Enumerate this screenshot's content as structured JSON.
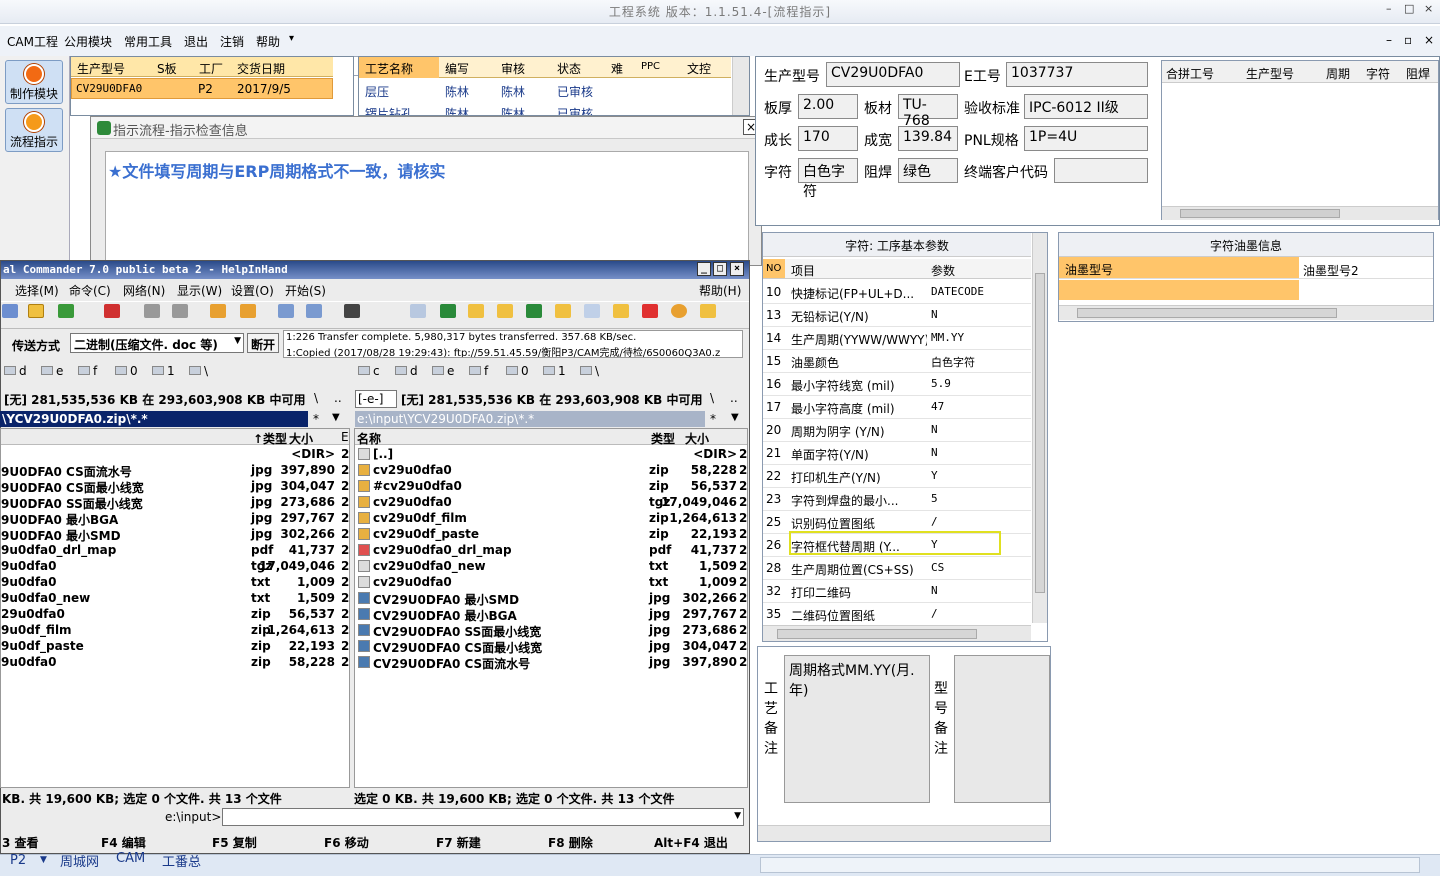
{
  "window": {
    "title": "工程系统 版本：1.1.51.4-[流程指示]",
    "controls": [
      "–",
      "□",
      "×"
    ]
  },
  "menu": {
    "items": [
      "CAM工程",
      "公用模块",
      "常用工具",
      "退出",
      "注销",
      "帮助"
    ],
    "help_arrow": "▾",
    "mdi_controls": [
      "–",
      "▫",
      "×"
    ]
  },
  "left_toolbar": {
    "buttons": [
      "制作模块",
      "流程指示"
    ]
  },
  "top_grid": {
    "headers": [
      "生产型号",
      "S板",
      "工厂",
      "交货日期"
    ],
    "row": [
      "CV29U0DFA0",
      "P2",
      "2017/9/5"
    ]
  },
  "process_grid": {
    "headers": [
      "工艺名称",
      "编写",
      "审核",
      "状态",
      "难",
      "PPC",
      "文控"
    ],
    "rows": [
      [
        "层压",
        "陈林",
        "陈林",
        "已审核"
      ],
      [
        "锣片钻孔",
        "陈林",
        "陈林",
        "已审核"
      ]
    ]
  },
  "dialog": {
    "title": "指示流程-指示检查信息",
    "message": "★文件填写周期与ERP周期格式不一致，请核实"
  },
  "info": {
    "fields": [
      {
        "label": "生产型号",
        "value": "CV29U0DFA0"
      },
      {
        "label": "E工号",
        "value": "1037737"
      },
      {
        "label": "板厚",
        "value": "2.00"
      },
      {
        "label": "板材",
        "value": "TU-768"
      },
      {
        "label": "验收标准",
        "value": "IPC-6012 II级"
      },
      {
        "label": "成长",
        "value": "170"
      },
      {
        "label": "成宽",
        "value": "139.84"
      },
      {
        "label": "PNL规格",
        "value": "1P=4U"
      },
      {
        "label": "字符",
        "value": "白色字符"
      },
      {
        "label": "阻焊",
        "value": "绿色"
      },
      {
        "label": "终端客户代码",
        "value": ""
      }
    ]
  },
  "merge_grid": {
    "headers": [
      "合拼工号",
      "生产型号",
      "周期",
      "字符",
      "阻焊"
    ]
  },
  "params": {
    "title": "字符: 工序基本参数",
    "headers": [
      "NO",
      "项目",
      "参数"
    ],
    "rows": [
      [
        "10",
        "快捷标记(FP+UL+D...",
        "DATECODE"
      ],
      [
        "13",
        "无铅标记(Y/N)",
        "N"
      ],
      [
        "14",
        "生产周期(YYWW/WWYY)",
        "MM.YY"
      ],
      [
        "15",
        "油墨颜色",
        "白色字符"
      ],
      [
        "16",
        "最小字符线宽 (mil)",
        "5.9"
      ],
      [
        "17",
        "最小字符高度 (mil)",
        "47"
      ],
      [
        "20",
        "周期为阴字 (Y/N)",
        "N"
      ],
      [
        "21",
        "单面字符(Y/N)",
        "N"
      ],
      [
        "22",
        "打印机生产(Y/N)",
        "Y"
      ],
      [
        "23",
        "字符到焊盘的最小...",
        "5"
      ],
      [
        "25",
        "识别码位置图纸",
        "/"
      ],
      [
        "26",
        "字符框代替周期 (Y...",
        "Y"
      ],
      [
        "28",
        "生产周期位置(CS+SS)",
        "CS"
      ],
      [
        "32",
        "打印二维码",
        "N"
      ],
      [
        "35",
        "二维码位置图纸",
        "/"
      ]
    ]
  },
  "ink": {
    "title": "字符油墨信息",
    "headers": [
      "油墨型号",
      "油墨型号2"
    ]
  },
  "remarks": {
    "process_label": "工艺备注",
    "process_text": "周期格式MM.YY(月.年)",
    "model_label": "型号备注"
  },
  "tc": {
    "title": "al Commander 7.0 public beta 2 - HelpInHand",
    "title_controls": [
      "_",
      "□",
      "×"
    ],
    "menu": [
      "选择(M)",
      "命令(C)",
      "网络(N)",
      "显示(W)",
      "设置(O)",
      "开始(S)"
    ],
    "help": "帮助(H)",
    "transfer_label": "传送方式",
    "transfer_mode": "二进制(压缩文件. doc 等)",
    "disconnect": "断开",
    "log": [
      "1:226 Transfer complete. 5,980,317 bytes transferred. 357.68 KB/sec.",
      "1:Copied (2017/08/28 19:29:43): ftp://59.51.45.59/衡阳P3/CAM完成/待检/6S0060Q3A0.z"
    ],
    "drives_left": [
      "d",
      "e",
      "f",
      "0",
      "1",
      "\\"
    ],
    "drives_right": [
      "c",
      "d",
      "e",
      "f",
      "0",
      "1",
      "\\"
    ],
    "left_free": "[无] 281,535,536 KB 在 293,603,908 KB 中可用",
    "right_free": "[无] 281,535,536 KB 在 293,603,908 KB 中可用",
    "right_drive": "[-e-]",
    "left_path": "\\YCV29U0DFA0.zip\\*.*",
    "right_path": "e:\\input\\YCV29U0DFA0.zip\\*.*",
    "left_cols": [
      "↑类型",
      "大小",
      "E"
    ],
    "right_cols": [
      "名称",
      "类型",
      "大小"
    ],
    "left_files": [
      [
        "",
        "",
        "<DIR>",
        "2"
      ],
      [
        "9U0DFA0 CS面流水号",
        "jpg",
        "397,890",
        "2"
      ],
      [
        "9U0DFA0 CS面最小线宽",
        "jpg",
        "304,047",
        "2"
      ],
      [
        "9U0DFA0 SS面最小线宽",
        "jpg",
        "273,686",
        "2"
      ],
      [
        "9U0DFA0 最小BGA",
        "jpg",
        "297,767",
        "2"
      ],
      [
        "9U0DFA0 最小SMD",
        "jpg",
        "302,266",
        "2"
      ],
      [
        "9u0dfa0_drl_map",
        "pdf",
        "41,737",
        "2"
      ],
      [
        "9u0dfa0",
        "tgz",
        "17,049,046",
        "2"
      ],
      [
        "9u0dfa0",
        "txt",
        "1,009",
        "2"
      ],
      [
        "9u0dfa0_new",
        "txt",
        "1,509",
        "2"
      ],
      [
        "29u0dfa0",
        "zip",
        "56,537",
        "2"
      ],
      [
        "9u0df_film",
        "zip",
        "1,264,613",
        "2"
      ],
      [
        "9u0df_paste",
        "zip",
        "22,193",
        "2"
      ],
      [
        "9u0dfa0",
        "zip",
        "58,228",
        "2"
      ]
    ],
    "right_files": [
      [
        "[..]",
        "",
        "<DIR>",
        "2"
      ],
      [
        "cv29u0dfa0",
        "zip",
        "58,228",
        "2"
      ],
      [
        "#cv29u0dfa0",
        "zip",
        "56,537",
        "2"
      ],
      [
        "cv29u0dfa0",
        "tgz",
        "17,049,046",
        "2"
      ],
      [
        "cv29u0df_film",
        "zip",
        "1,264,613",
        "2"
      ],
      [
        "cv29u0df_paste",
        "zip",
        "22,193",
        "2"
      ],
      [
        "cv29u0dfa0_drl_map",
        "pdf",
        "41,737",
        "2"
      ],
      [
        "cv29u0dfa0_new",
        "txt",
        "1,509",
        "2"
      ],
      [
        "cv29u0dfa0",
        "txt",
        "1,009",
        "2"
      ],
      [
        "CV29U0DFA0 最小SMD",
        "jpg",
        "302,266",
        "2"
      ],
      [
        "CV29U0DFA0 最小BGA",
        "jpg",
        "297,767",
        "2"
      ],
      [
        "CV29U0DFA0 SS面最小线宽",
        "jpg",
        "273,686",
        "2"
      ],
      [
        "CV29U0DFA0 CS面最小线宽",
        "jpg",
        "304,047",
        "2"
      ],
      [
        "CV29U0DFA0 CS面流水号",
        "jpg",
        "397,890",
        "2"
      ]
    ],
    "left_status": "KB. 共 19,600 KB; 选定 0 个文件. 共 13 个文件",
    "right_status": "选定 0 KB. 共 19,600 KB; 选定 0 个文件. 共 13 个文件",
    "cmd_path": "e:\\input>",
    "fkeys": [
      "3 查看",
      "F4 编辑",
      "F5 复制",
      "F6 移动",
      "F7 新建",
      "F8 删除",
      "Alt+F4 退出"
    ]
  },
  "taskbar": {
    "items": [
      "P2",
      "周城网",
      "CAM",
      "工番总"
    ]
  }
}
